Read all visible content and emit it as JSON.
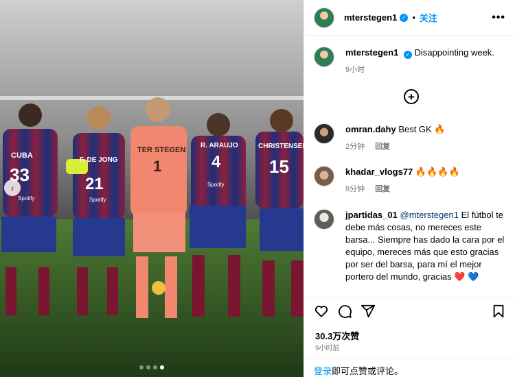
{
  "photo": {
    "jerseys": [
      {
        "name": "CUBA",
        "number": "33"
      },
      {
        "name": "F. DE JONG",
        "number": "21"
      },
      {
        "name": "TER STEGEN",
        "number": "1"
      },
      {
        "name": "R. ARAUJO",
        "number": "4"
      },
      {
        "name": "CHRISTENSEN",
        "number": "15"
      }
    ],
    "sponsor": "Spotify",
    "carousel_dots": 4,
    "active_dot": 4,
    "prev_icon": "chevron-left-icon"
  },
  "header": {
    "username": "mterstegen1",
    "separator": "•",
    "follow_label": "关注",
    "more_label": "•••"
  },
  "caption": {
    "username": "mterstegen1",
    "text": "Disappointing week.",
    "time": "9小时"
  },
  "load_more_label": "+",
  "comments": [
    {
      "username": "omran.dahy",
      "text": "Best GK 🔥",
      "time": "2分钟",
      "reply": "回复"
    },
    {
      "username": "khadar_vlogs77",
      "text": "🔥🔥🔥🔥",
      "time": "8分钟",
      "reply": "回复"
    },
    {
      "username": "jpartidas_01",
      "mention": "@mterstegen1",
      "text": " El fútbol te debe más cosas, no mereces este barsa... Siempre has dado la cara por el equipo, mereces más que esto gracias por ser del barsa, para mí el mejor portero del mundo, gracias ❤️ 💙"
    }
  ],
  "stats": {
    "likes": "30.3万次赞",
    "time": "9小时前"
  },
  "footer": {
    "login": "登录",
    "rest": "即可点赞或评论。"
  },
  "colors": {
    "accent": "#0095f6",
    "mention": "#00376b",
    "muted": "#737373"
  }
}
